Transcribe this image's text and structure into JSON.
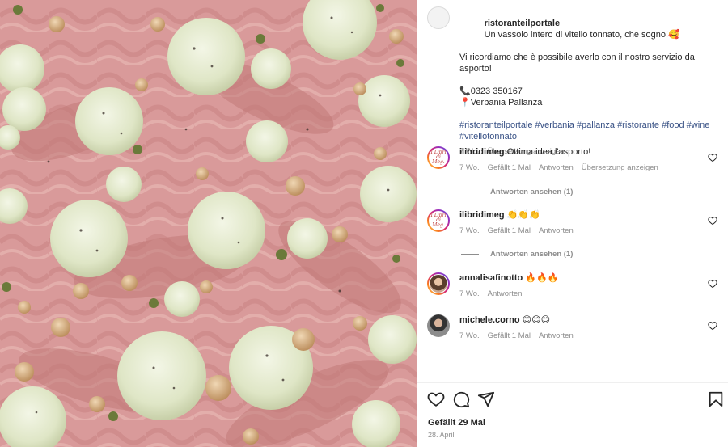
{
  "photo": {
    "alt_subject": "vitello tonnato tray",
    "base_color": "#d9a7a4",
    "sauce_color": "#e6ecd4",
    "hazelnut_color": "#d8b48a",
    "caper_color": "#6b7a3a"
  },
  "post": {
    "author": "ristoranteilportale",
    "caption_line1": "Un vassoio intero di vitello tonnato, che sogno!🥰",
    "caption_line2": "Vi ricordiamo che è possibile averlo con il nostro servizio da asporto!",
    "phone": "📞0323 350167",
    "location": "📍Verbania Pallanza",
    "hashtags": "#ristoranteilportale #verbania #pallanza #ristorante #food #wine #vitellotonnato",
    "time": "7 Wo.",
    "translate": "Übersetzung anzeigen"
  },
  "comments": [
    {
      "user": "ilibridimeg",
      "text": "Ottima idea l'asporto!",
      "time": "7 Wo.",
      "likes": "Gefällt 1 Mal",
      "reply": "Antworten",
      "translate": "Übersetzung anzeigen",
      "view_replies": "Antworten ansehen (1)",
      "avatar_text": "I Libri di Meg."
    },
    {
      "user": "ilibridimeg",
      "text": "👏👏👏",
      "time": "7 Wo.",
      "likes": "Gefällt 1 Mal",
      "reply": "Antworten",
      "view_replies": "Antworten ansehen (1)",
      "avatar_text": "I Libri di Meg."
    },
    {
      "user": "annalisafinotto",
      "text": "🔥🔥🔥",
      "time": "7 Wo.",
      "reply": "Antworten"
    },
    {
      "user": "michele.corno",
      "text": "😊😊😊",
      "time": "7 Wo.",
      "likes": "Gefällt 1 Mal",
      "reply": "Antworten"
    }
  ],
  "footer": {
    "likes": "Gefällt 29 Mal",
    "date": "28. April"
  },
  "icons": [
    "heart-icon",
    "comment-icon",
    "share-icon",
    "bookmark-icon"
  ]
}
